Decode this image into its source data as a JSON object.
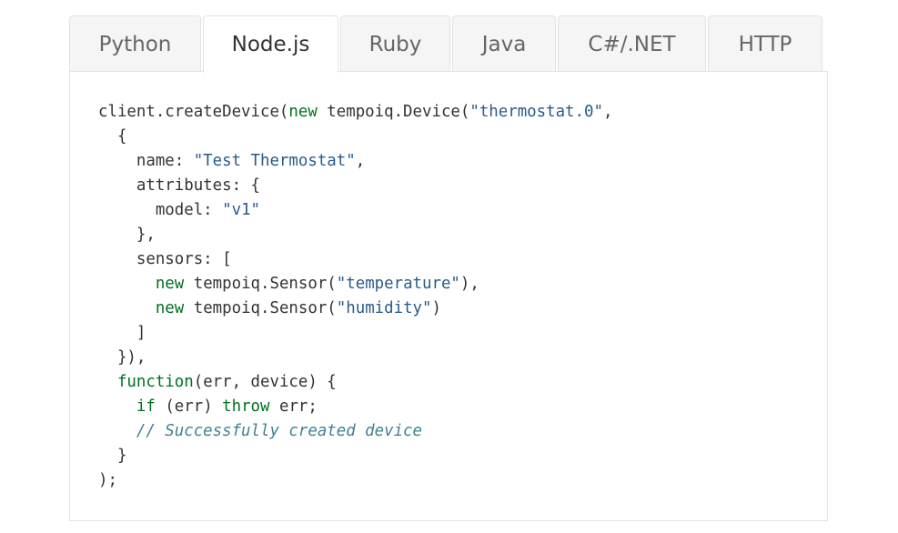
{
  "tabs": [
    {
      "label": "Python",
      "active": false
    },
    {
      "label": "Node.js",
      "active": true
    },
    {
      "label": "Ruby",
      "active": false
    },
    {
      "label": "Java",
      "active": false
    },
    {
      "label": "C#/.NET",
      "active": false
    },
    {
      "label": "HTTP",
      "active": false
    }
  ],
  "colors": {
    "keyword": "#007020",
    "string": "#2a5a8a",
    "comment": "#408090",
    "text": "#333333",
    "tab_inactive_bg": "#f5f5f5",
    "border": "#e3e3e3"
  },
  "code": {
    "language": "Node.js",
    "lines": [
      [
        {
          "t": "client.createDevice("
        },
        {
          "t": "new",
          "k": "kw"
        },
        {
          "t": " tempoiq.Device("
        },
        {
          "t": "\"thermostat.0\"",
          "k": "st"
        },
        {
          "t": ","
        }
      ],
      [
        {
          "t": "  {"
        }
      ],
      [
        {
          "t": "    name: "
        },
        {
          "t": "\"Test Thermostat\"",
          "k": "st"
        },
        {
          "t": ","
        }
      ],
      [
        {
          "t": "    attributes: {"
        }
      ],
      [
        {
          "t": "      model: "
        },
        {
          "t": "\"v1\"",
          "k": "st"
        }
      ],
      [
        {
          "t": "    },"
        }
      ],
      [
        {
          "t": "    sensors: ["
        }
      ],
      [
        {
          "t": "      "
        },
        {
          "t": "new",
          "k": "kw"
        },
        {
          "t": " tempoiq.Sensor("
        },
        {
          "t": "\"temperature\"",
          "k": "st"
        },
        {
          "t": "),"
        }
      ],
      [
        {
          "t": "      "
        },
        {
          "t": "new",
          "k": "kw"
        },
        {
          "t": " tempoiq.Sensor("
        },
        {
          "t": "\"humidity\"",
          "k": "st"
        },
        {
          "t": ")"
        }
      ],
      [
        {
          "t": "    ]"
        }
      ],
      [
        {
          "t": "  }),"
        }
      ],
      [
        {
          "t": "  "
        },
        {
          "t": "function",
          "k": "kw"
        },
        {
          "t": "(err, device) {"
        }
      ],
      [
        {
          "t": "    "
        },
        {
          "t": "if",
          "k": "kw"
        },
        {
          "t": " (err) "
        },
        {
          "t": "throw",
          "k": "kw"
        },
        {
          "t": " err;"
        }
      ],
      [
        {
          "t": "    "
        },
        {
          "t": "// Successfully created device",
          "k": "cm"
        }
      ],
      [
        {
          "t": "  }"
        }
      ],
      [
        {
          "t": ");"
        }
      ]
    ]
  }
}
